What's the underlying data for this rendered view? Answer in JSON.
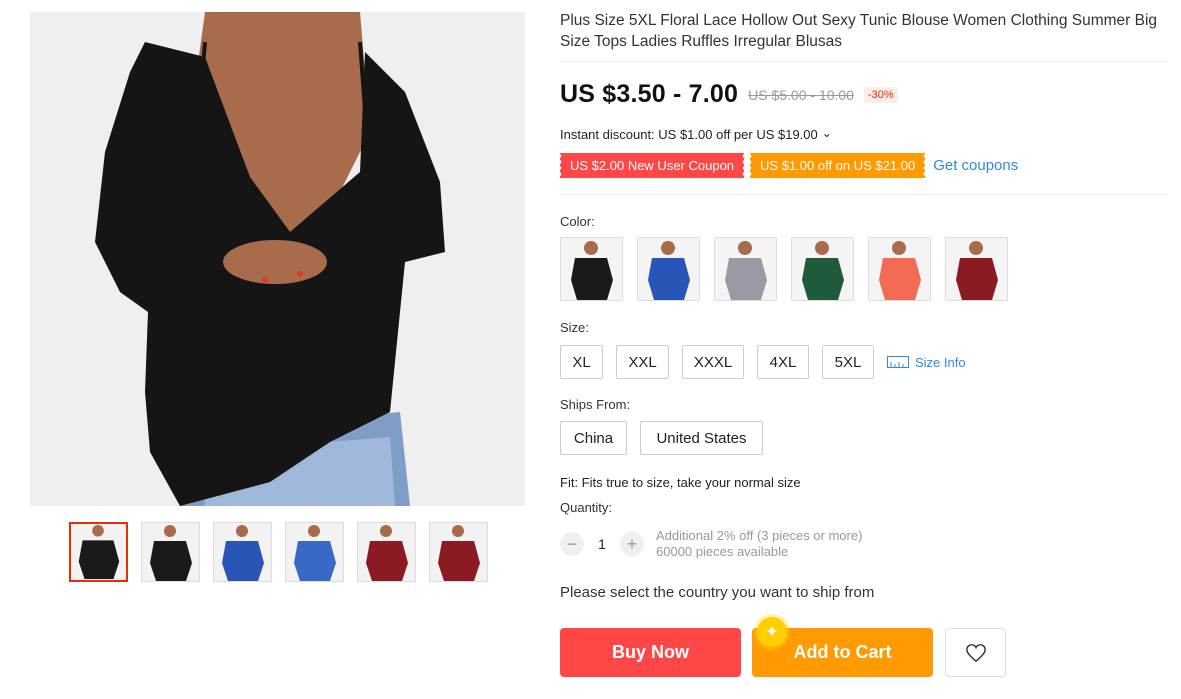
{
  "product": {
    "title": "Plus Size 5XL Floral Lace Hollow Out Sexy Tunic Blouse Women Clothing Summer Big Size Tops Ladies Ruffles Irregular Blusas"
  },
  "pricing": {
    "price": "US $3.50 - 7.00",
    "original_price": "US $5.00 - 10.00",
    "discount": "-30%",
    "instant_discount": "Instant discount: US $1.00 off per US $19.00",
    "instant_chevron": "⌄"
  },
  "coupons": {
    "new_user": "US $2.00 New User Coupon",
    "store": "US $1.00 off on US $21.00",
    "get_coupons": "Get coupons"
  },
  "color": {
    "label": "Color:",
    "options": [
      {
        "name": "black",
        "hex": "#1a1a1a"
      },
      {
        "name": "blue",
        "hex": "#2a55b8"
      },
      {
        "name": "gray",
        "hex": "#9a9aa4"
      },
      {
        "name": "green",
        "hex": "#1f5a3a"
      },
      {
        "name": "coral",
        "hex": "#f46b55"
      },
      {
        "name": "wine",
        "hex": "#8b1a22"
      }
    ]
  },
  "size": {
    "label": "Size:",
    "options": [
      "XL",
      "XXL",
      "XXXL",
      "4XL",
      "5XL"
    ],
    "size_info": "Size Info"
  },
  "ships_from": {
    "label": "Ships From:",
    "options": [
      "China",
      "United States"
    ]
  },
  "fit": "Fit: Fits true to size, take your normal size",
  "quantity": {
    "label": "Quantity:",
    "value": "1",
    "minus": "−",
    "plus": "+",
    "note_1": "Additional 2% off (3 pieces or more)",
    "note_2": "60000 pieces available"
  },
  "ship_from_msg": "Please select the country you want to ship from",
  "actions": {
    "buy_now": "Buy Now",
    "add_to_cart": "Add to Cart"
  },
  "gallery": {
    "thumbnail_colors": [
      "#1a1a1a",
      "#1a1a1a",
      "#2a55b8",
      "#3a68c6",
      "#8b1a22",
      "#8b1a22"
    ],
    "selected_index": 0
  },
  "accent_colors": {
    "buy": "#ff4747",
    "cart": "#ff9a00",
    "link": "#2f8ad8"
  }
}
